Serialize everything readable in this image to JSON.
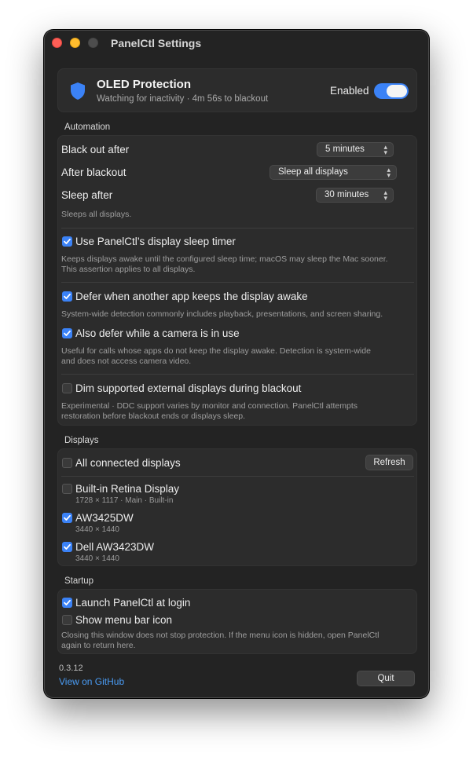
{
  "window": {
    "title": "PanelCtl Settings"
  },
  "hero": {
    "title": "OLED Protection",
    "subtitle": "Watching for inactivity · 4m 56s to blackout",
    "toggle_label": "Enabled",
    "enabled": true
  },
  "automation": {
    "section_title": "Automation",
    "black_out_after": {
      "label": "Black out after",
      "value": "5 minutes"
    },
    "after_blackout": {
      "label": "After blackout",
      "value": "Sleep all displays"
    },
    "sleep_after": {
      "label": "Sleep after",
      "value": "30 minutes"
    },
    "sleep_hint": "Sleeps all displays.",
    "use_sleep_timer": {
      "label": "Use PanelCtl’s display sleep timer",
      "checked": true,
      "hint1": "Keeps displays awake until the configured sleep time; macOS may sleep the Mac sooner.",
      "hint2": "This assertion applies to all displays."
    },
    "defer_app": {
      "label": "Defer when another app keeps the display awake",
      "checked": true,
      "hint": "System-wide detection commonly includes playback, presentations, and screen sharing."
    },
    "defer_camera": {
      "label": "Also defer while a camera is in use",
      "checked": true,
      "hint1": "Useful for calls whose apps do not keep the display awake. Detection is system-wide",
      "hint2": "and does not access camera video."
    },
    "dim_external": {
      "label": "Dim supported external displays during blackout",
      "checked": false,
      "hint1": "Experimental · DDC support varies by monitor and connection. PanelCtl attempts",
      "hint2": "restoration before blackout ends or displays sleep."
    }
  },
  "displays": {
    "section_title": "Displays",
    "all_label": "All connected displays",
    "all_checked": false,
    "refresh_label": "Refresh",
    "items": [
      {
        "name": "Built-in Retina Display",
        "detail": "1728 × 1117 · Main · Built-in",
        "checked": false
      },
      {
        "name": "AW3425DW",
        "detail": "3440 × 1440",
        "checked": true
      },
      {
        "name": "Dell AW3423DW",
        "detail": "3440 × 1440",
        "checked": true
      }
    ]
  },
  "startup": {
    "section_title": "Startup",
    "launch_label": "Launch PanelCtl at login",
    "launch_checked": true,
    "menu_icon_label": "Show menu bar icon",
    "menu_icon_checked": false,
    "hint1": "Closing this window does not stop protection. If the menu icon is hidden, open PanelCtl",
    "hint2": "again to return here."
  },
  "footer": {
    "version": "0.3.12",
    "github_link": "View on GitHub",
    "quit_label": "Quit"
  },
  "colors": {
    "accent": "#3b82f6",
    "link": "#4a9cf5",
    "close": "#fe5f57",
    "minimize": "#febc2e"
  },
  "icons": {
    "hero": "shield-icon",
    "checkmark": "checkmark-icon",
    "select": "chevron-up-down-icon"
  }
}
